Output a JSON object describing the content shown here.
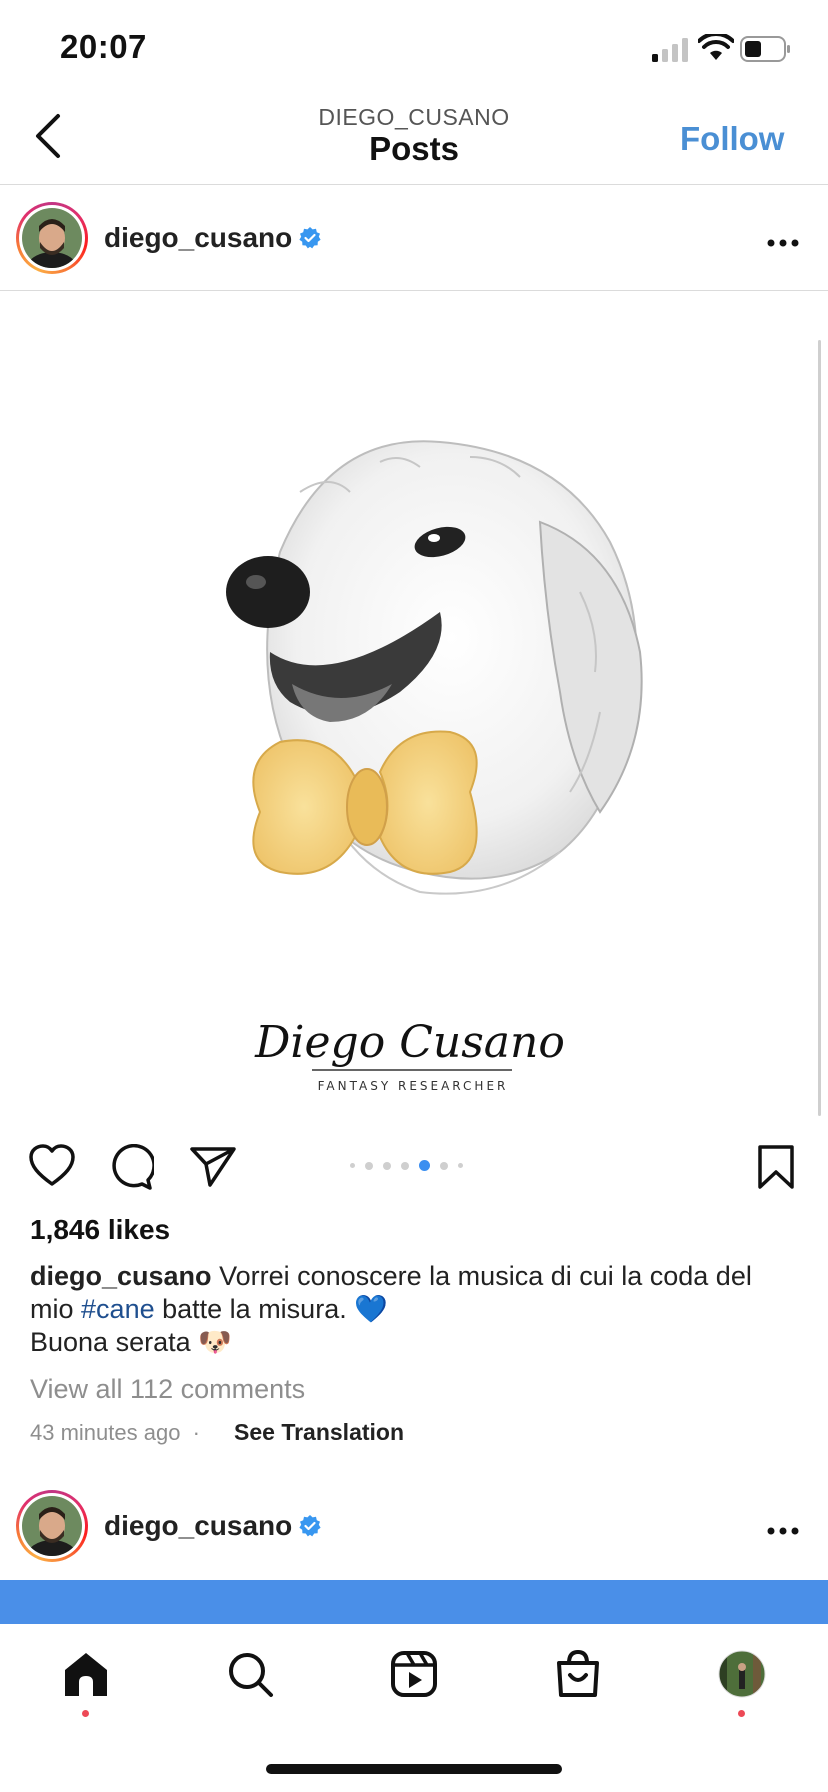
{
  "status_bar": {
    "time": "20:07",
    "icons": [
      "signal-icon",
      "wifi-icon",
      "battery-icon"
    ]
  },
  "header": {
    "username": "DIEGO_CUSANO",
    "title": "Posts",
    "follow_label": "Follow",
    "back_icon": "chevron-left-icon"
  },
  "colors": {
    "link_blue": "#4a8fd4",
    "hashtag": "#1f4f8f",
    "active_dot": "#3b8ff0",
    "notification_dot": "#ed4956",
    "strip_blue": "#4a8fe8"
  },
  "post": {
    "username": "diego_cusano",
    "verified": true,
    "more_icon": "more-horizontal-icon",
    "image_logo": {
      "name": "Diego Cusano",
      "tagline": "FANTASY RESEARCHER"
    },
    "carousel": {
      "count": 7,
      "active_index": 4
    },
    "actions": [
      "heart-icon",
      "comment-icon",
      "share-icon",
      "bookmark-icon"
    ],
    "likes": "1,846 likes",
    "caption": {
      "user": "diego_cusano",
      "text_before": "Vorrei conoscere la musica di cui la coda del mio",
      "hashtag": "#cane",
      "text_after": "batte la misura. 💙",
      "line2": "Buona serata 🐶"
    },
    "view_comments": "View all 112 comments",
    "time_ago": "43 minutes ago",
    "separator": "·",
    "see_translation": "See Translation"
  },
  "next_post": {
    "username": "diego_cusano",
    "verified": true
  },
  "tab_bar": [
    "home-icon",
    "search-icon",
    "reels-icon",
    "shop-icon",
    "profile-avatar"
  ]
}
